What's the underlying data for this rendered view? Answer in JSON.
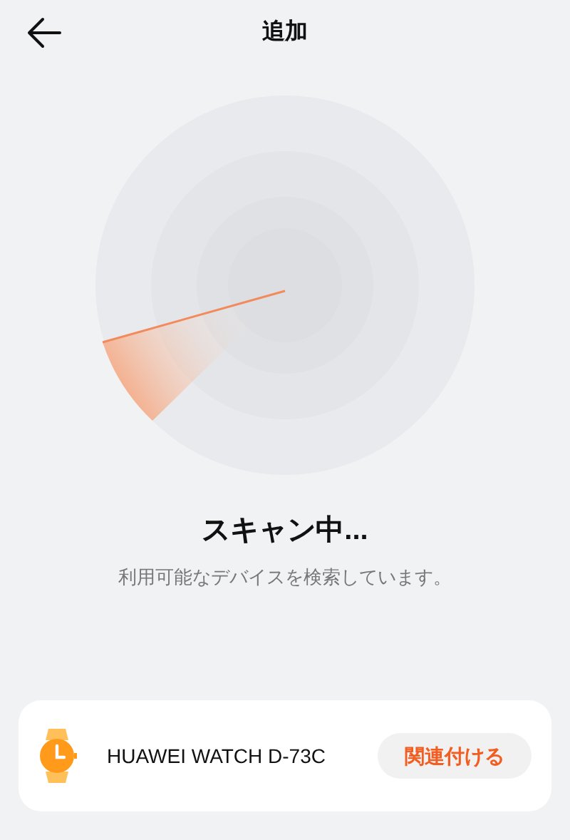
{
  "header": {
    "title": "追加"
  },
  "scan": {
    "title": "スキャン中...",
    "subtitle": "利用可能なデバイスを検索しています。"
  },
  "device": {
    "name": "HUAWEI WATCH D-73C",
    "action": "関連付ける"
  }
}
